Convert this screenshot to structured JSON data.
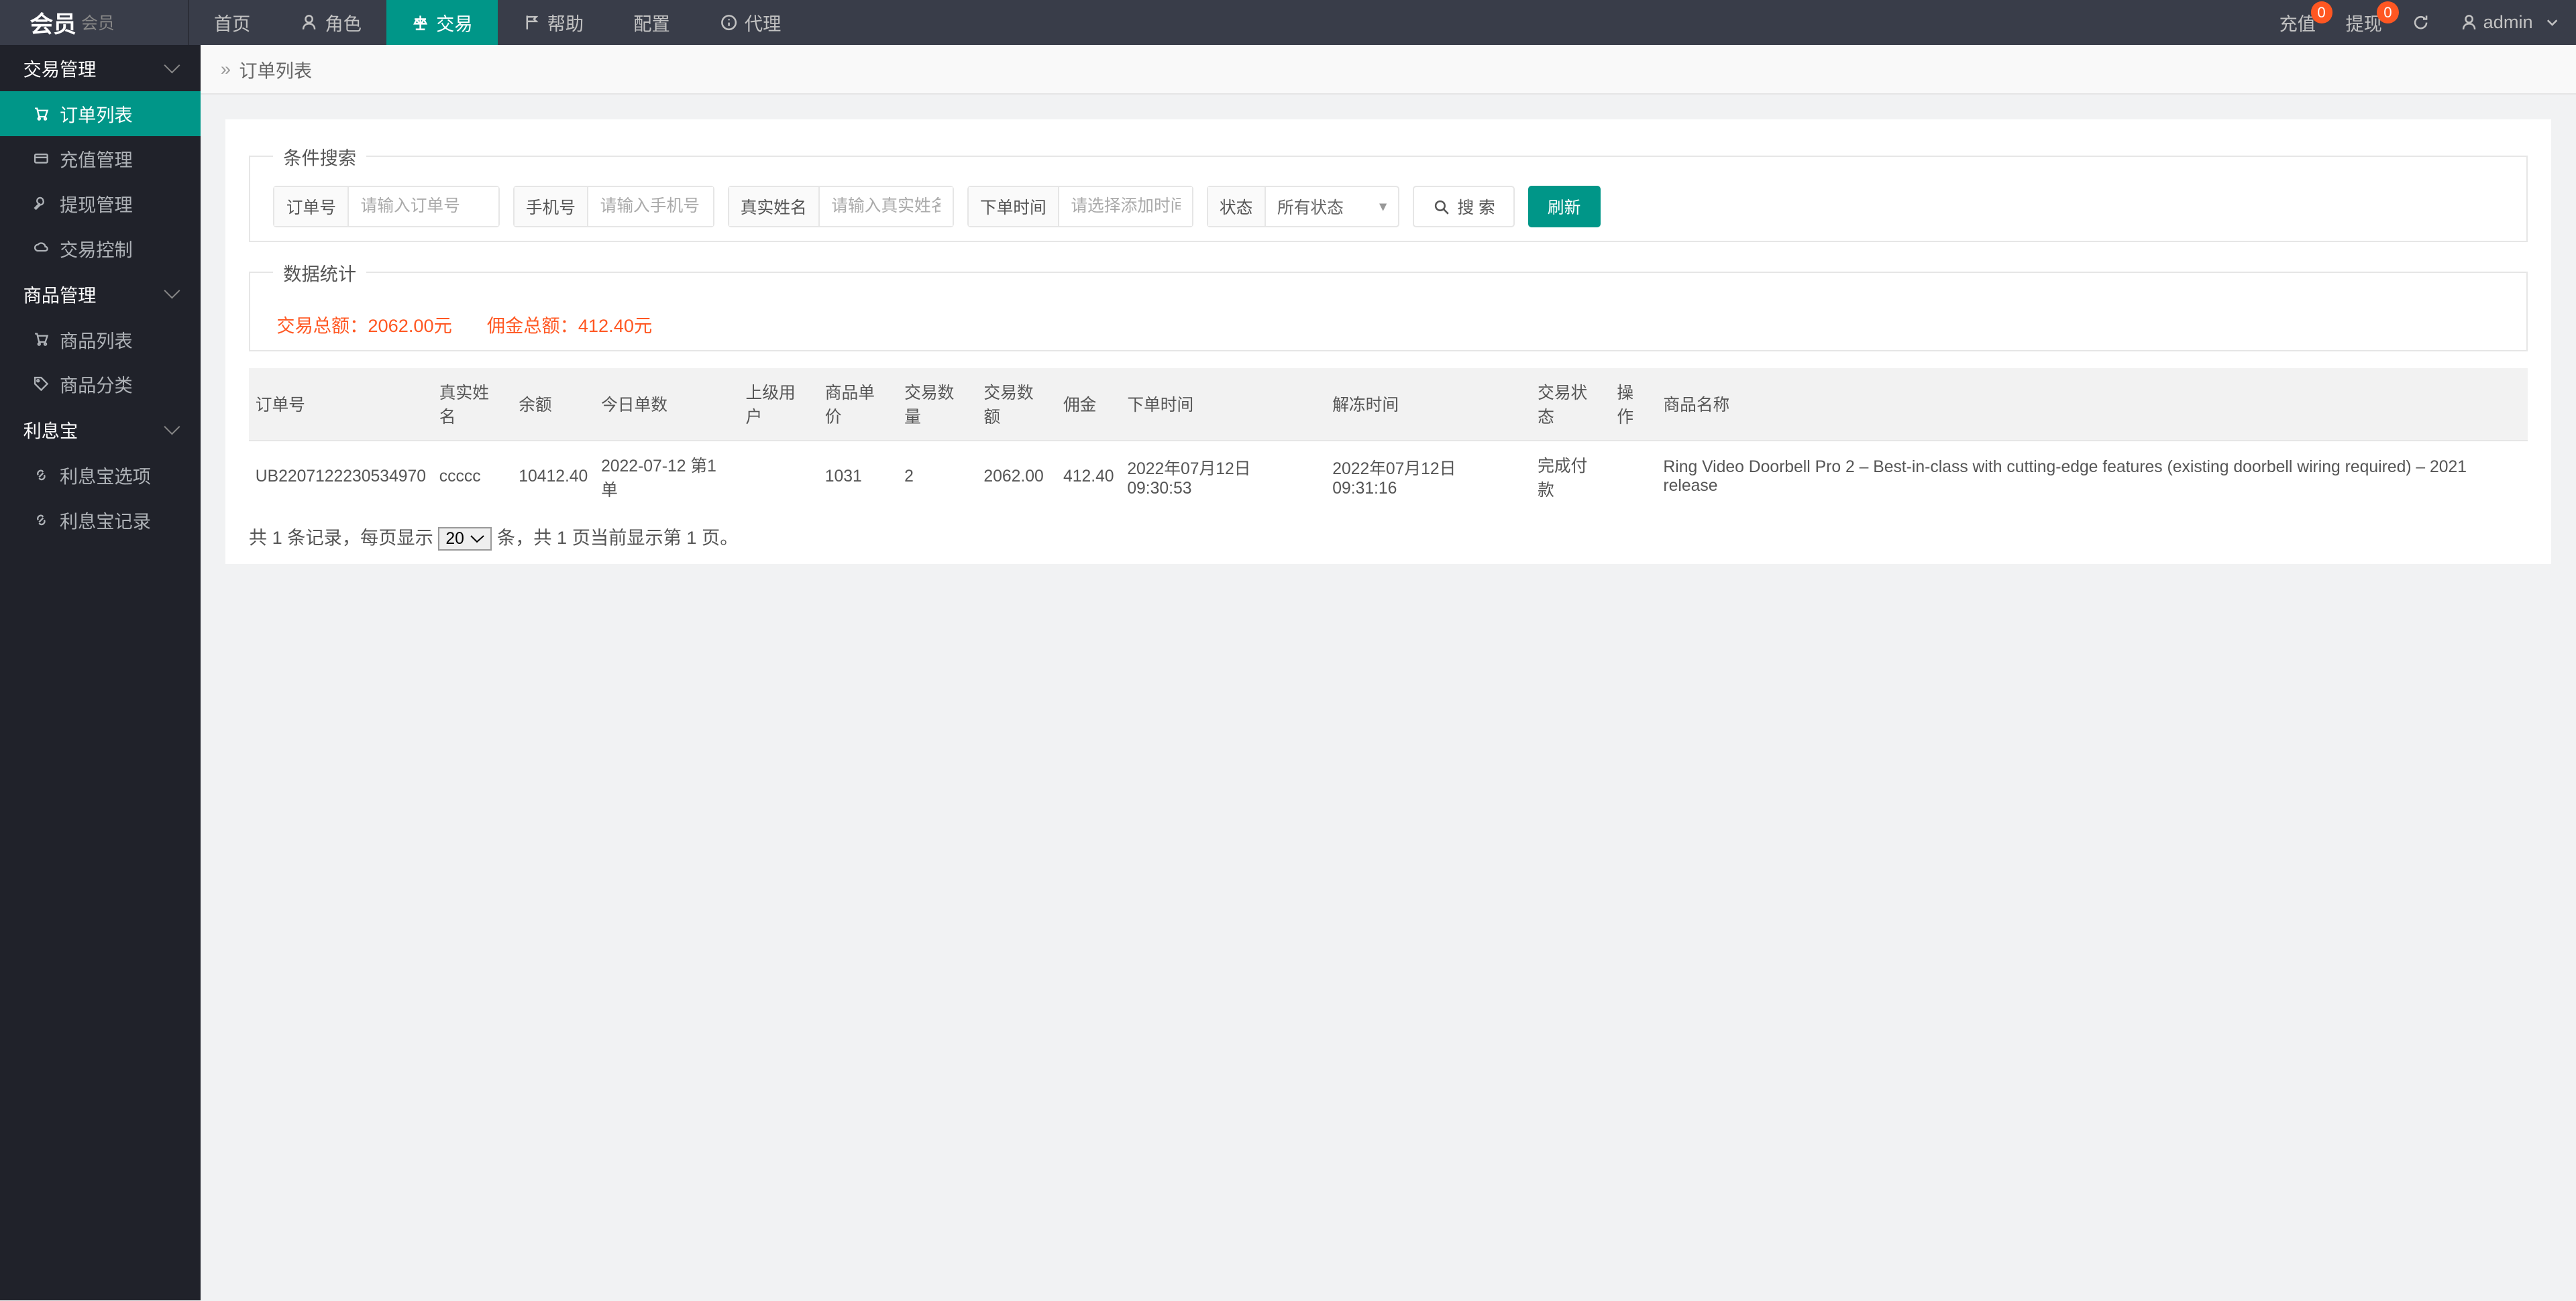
{
  "logo": {
    "main": "会员",
    "sub": "会员"
  },
  "topnav": {
    "home": "首页",
    "role": "角色",
    "trade": "交易",
    "help": "帮助",
    "config": "配置",
    "agent": "代理"
  },
  "topright": {
    "recharge": "充值",
    "recharge_badge": "0",
    "withdraw": "提现",
    "withdraw_badge": "0",
    "user": "admin"
  },
  "sidebar": {
    "g_trade": "交易管理",
    "order_list": "订单列表",
    "recharge_mgmt": "充值管理",
    "withdraw_mgmt": "提现管理",
    "trade_ctrl": "交易控制",
    "g_goods": "商品管理",
    "goods_list": "商品列表",
    "goods_cat": "商品分类",
    "g_interest": "利息宝",
    "interest_opt": "利息宝选项",
    "interest_rec": "利息宝记录"
  },
  "breadcrumb": "订单列表",
  "search": {
    "legend": "条件搜索",
    "f1_label": "订单号",
    "f1_ph": "请输入订单号",
    "f2_label": "手机号",
    "f2_ph": "请输入手机号",
    "f3_label": "真实姓名",
    "f3_ph": "请输入真实姓名",
    "f4_label": "下单时间",
    "f4_ph": "请选择添加时间",
    "f5_label": "状态",
    "f5_sel": "所有状态",
    "btn_search": "搜 索",
    "btn_refresh": "刷新"
  },
  "stats": {
    "legend": "数据统计",
    "trade": "交易总额：2062.00元",
    "comm": "佣金总额：412.40元"
  },
  "table": {
    "headers": [
      "订单号",
      "真实姓名",
      "余额",
      "今日单数",
      "上级用户",
      "商品单价",
      "交易数量",
      "交易数额",
      "佣金",
      "下单时间",
      "解冻时间",
      "交易状态",
      "操作",
      "商品名称"
    ],
    "row": {
      "c0": "UB2207122230534970",
      "c1": "ccccc",
      "c2": "10412.40",
      "c3": "2022-07-12 第1单",
      "c4": "",
      "c5": "1031",
      "c6": "2",
      "c7": "2062.00",
      "c8": "412.40",
      "c9": "2022年07月12日 09:30:53",
      "c10": "2022年07月12日 09:31:16",
      "c11": "完成付款",
      "c12": "",
      "c13": "Ring Video Doorbell Pro 2 – Best-in-class with cutting-edge features (existing doorbell wiring required) – 2021 release"
    }
  },
  "pager": {
    "prefix": "共 1 条记录，每页显示 ",
    "sel": "20",
    "suffix": " 条，共 1 页当前显示第 1 页。"
  }
}
